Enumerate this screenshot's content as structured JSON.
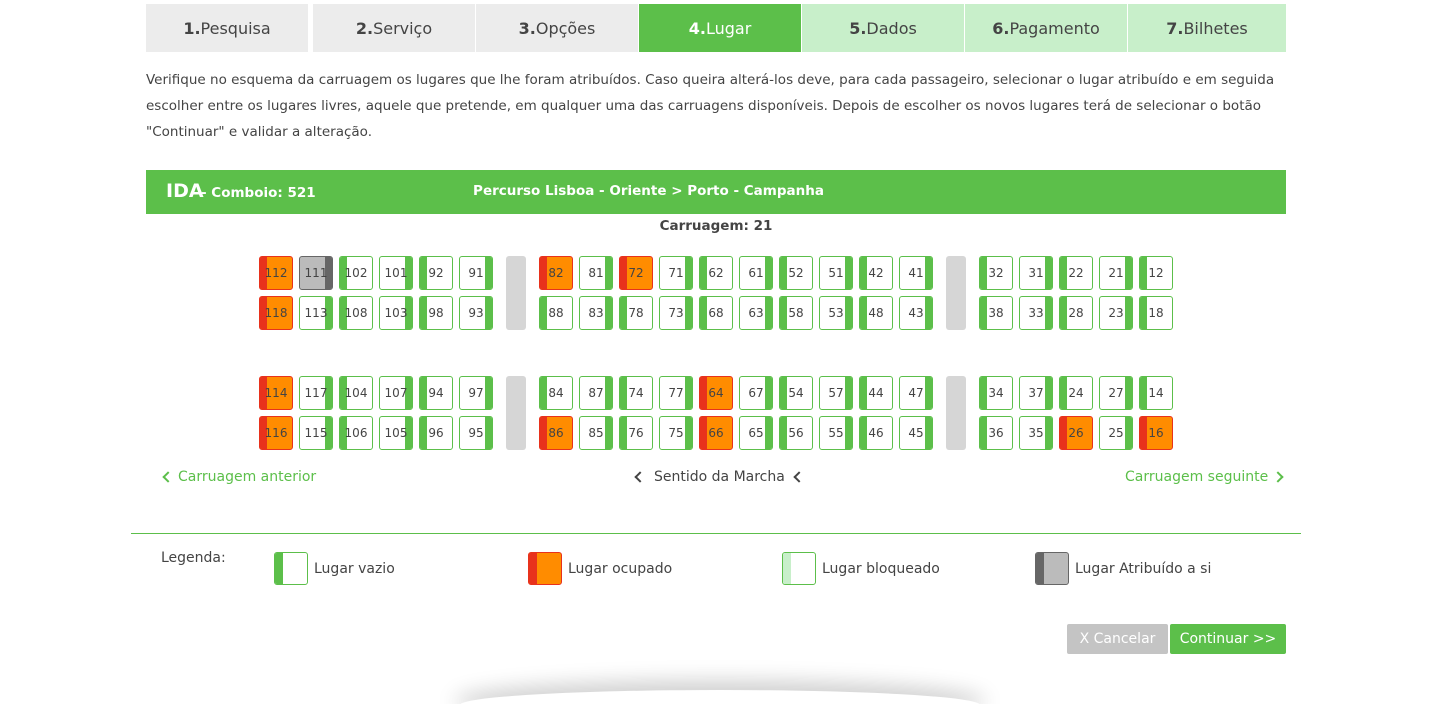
{
  "steps": [
    {
      "num": "1.",
      "label": "Pesquisa",
      "state": "past"
    },
    {
      "num": "2.",
      "label": "Serviço",
      "state": "past"
    },
    {
      "num": "3.",
      "label": "Opções",
      "state": "past"
    },
    {
      "num": "4.",
      "label": "Lugar",
      "state": "active"
    },
    {
      "num": "5.",
      "label": "Dados",
      "state": "future"
    },
    {
      "num": "6.",
      "label": "Pagamento",
      "state": "future"
    },
    {
      "num": "7.",
      "label": "Bilhetes",
      "state": "future"
    }
  ],
  "intro": "Verifique no esquema da carruagem os lugares que lhe foram atribuídos. Caso queira alterá-los deve, para cada passageiro, selecionar o lugar atribuído e em seguida escolher entre os lugares livres, aquele que pretende, em qualquer uma das carruagens disponíveis. Depois de escolher os novos lugares terá de selecionar o botão \"Continuar\" e validar a alteração.",
  "trip": {
    "direction": "IDA",
    "train": "- Comboio: 521",
    "route": "Percurso Lisboa - Oriente > Porto - Campanha"
  },
  "carriage_label": "Carruagem: 21",
  "seat_rows": [
    [
      "112",
      "111",
      "102",
      "101",
      "92",
      "91",
      "82",
      "81",
      "72",
      "71",
      "62",
      "61",
      "52",
      "51",
      "42",
      "41",
      "32",
      "31",
      "22",
      "21",
      "12"
    ],
    [
      "118",
      "113",
      "108",
      "103",
      "98",
      "93",
      "88",
      "83",
      "78",
      "73",
      "68",
      "63",
      "58",
      "53",
      "48",
      "43",
      "38",
      "33",
      "28",
      "23",
      "18"
    ],
    [
      "114",
      "117",
      "104",
      "107",
      "94",
      "97",
      "84",
      "87",
      "74",
      "77",
      "64",
      "67",
      "54",
      "57",
      "44",
      "47",
      "34",
      "37",
      "24",
      "27",
      "14"
    ],
    [
      "116",
      "115",
      "106",
      "105",
      "96",
      "95",
      "86",
      "85",
      "76",
      "75",
      "66",
      "65",
      "56",
      "55",
      "46",
      "45",
      "36",
      "35",
      "26",
      "25",
      "16"
    ]
  ],
  "occupied_seats": [
    "112",
    "118",
    "114",
    "116",
    "82",
    "72",
    "86",
    "64",
    "66",
    "26",
    "16"
  ],
  "assigned_seats": [
    "111"
  ],
  "nav": {
    "prev": "Carruagem anterior",
    "direction": "Sentido da Marcha",
    "next": "Carruagem seguinte"
  },
  "legend": {
    "title": "Legenda:",
    "empty": "Lugar vazio",
    "occupied": "Lugar ocupado",
    "blocked": "Lugar bloqueado",
    "assigned": "Lugar Atribuído a si"
  },
  "buttons": {
    "cancel": "X Cancelar",
    "continue": "Continuar >>"
  },
  "colors": {
    "accent_green": "#5cbf4a",
    "light_green": "#c8efca",
    "occupied_orange": "#ff8c00",
    "occupied_red": "#e8321c",
    "assigned_gray": "#bbbbbb"
  }
}
